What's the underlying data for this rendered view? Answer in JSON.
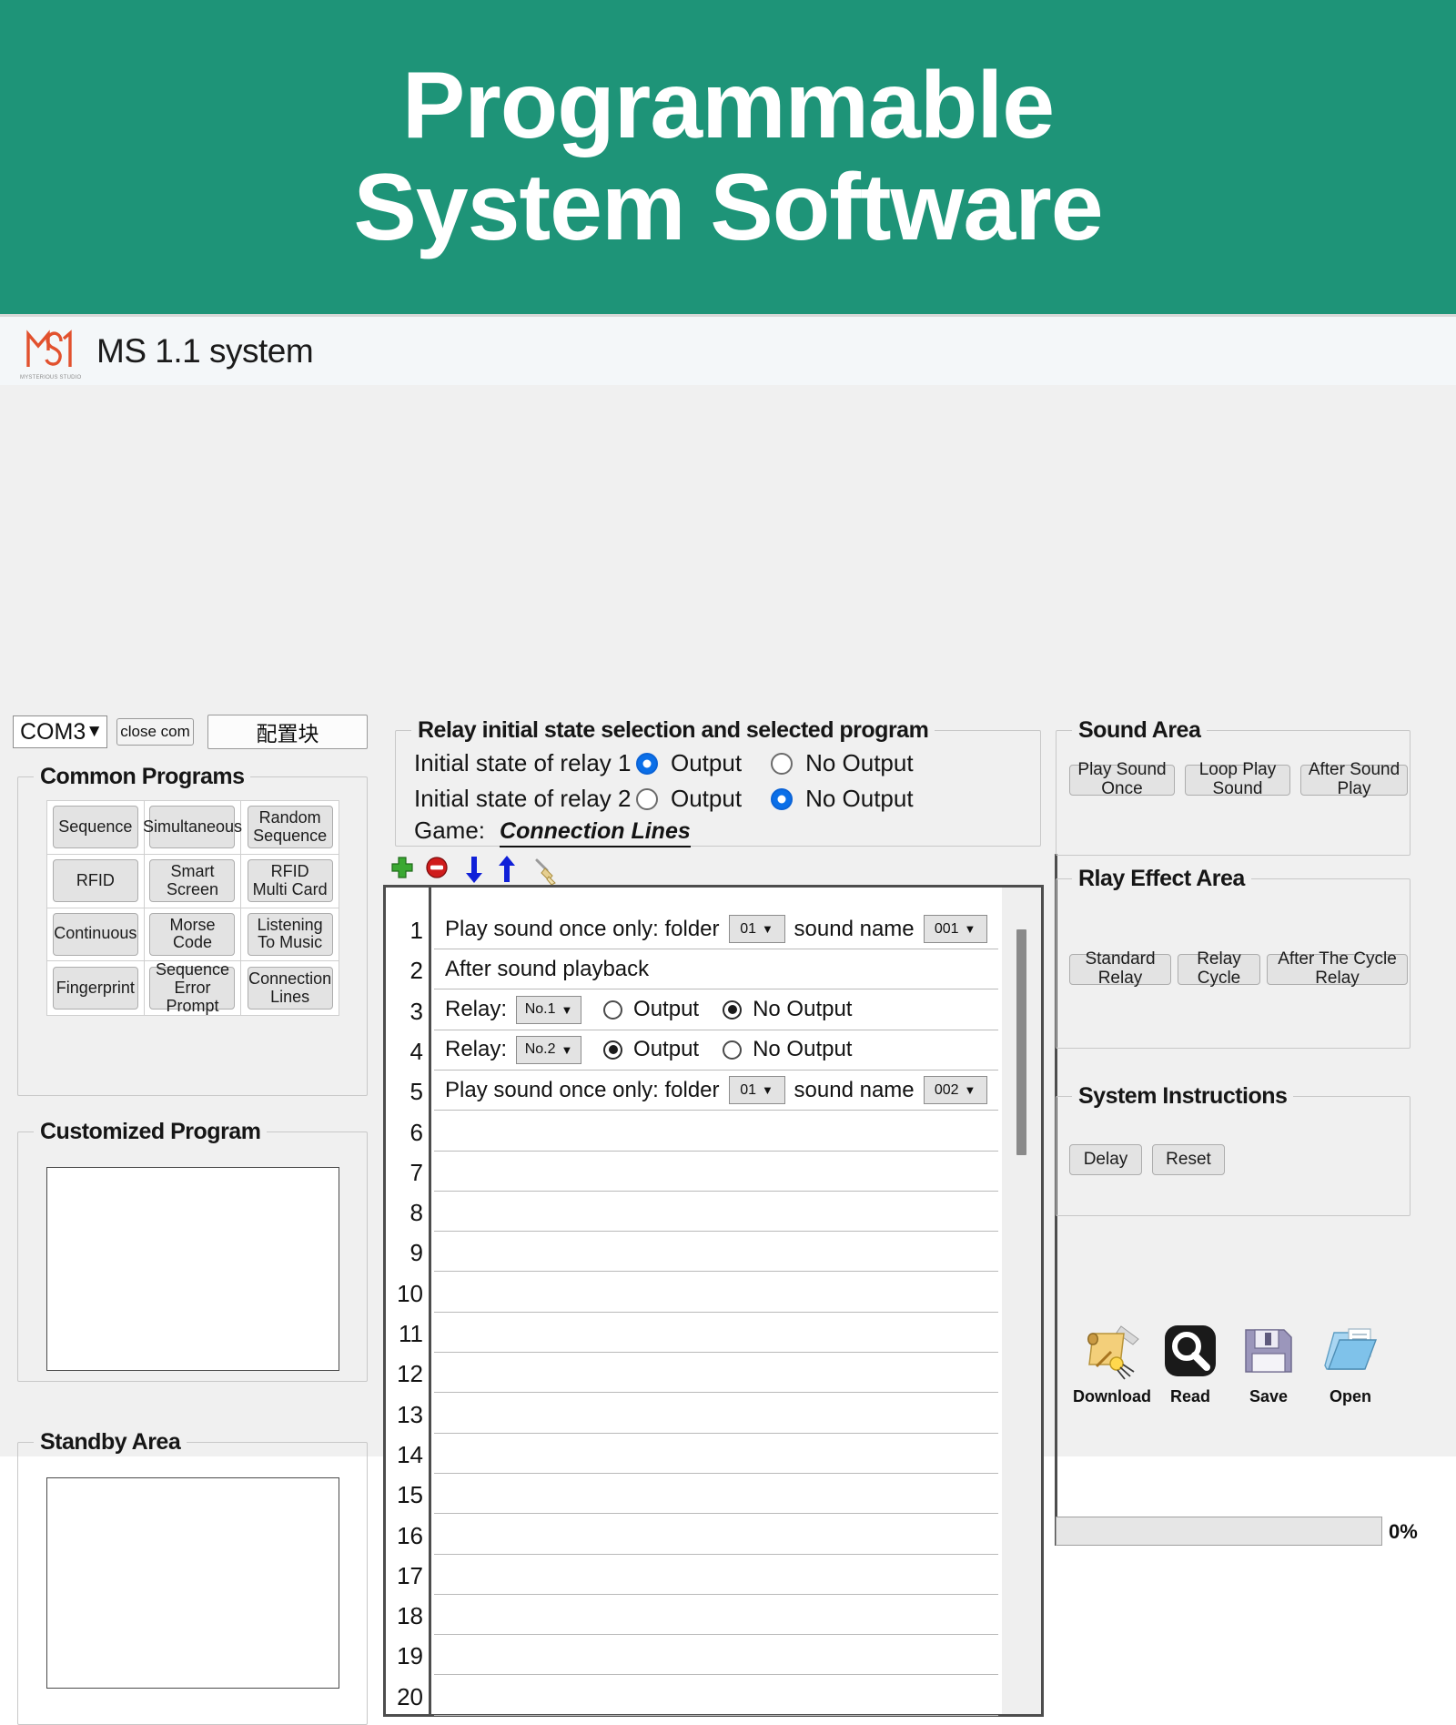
{
  "banner": {
    "line1": "Programmable",
    "line2": "System Software",
    "bg_color": "#1e9478"
  },
  "titlebar": {
    "app_title": "MS 1.1 system",
    "logo_caption": "MYSTERIOUS STUDIO"
  },
  "connection": {
    "port_value": "COM3",
    "caret": "▼",
    "close_com_label": "close com",
    "config_block_label": "配置块"
  },
  "common_programs": {
    "legend": "Common Programs",
    "buttons": [
      "Sequence",
      "Simultaneous",
      "Random\nSequence",
      "RFID",
      "Smart\nScreen",
      "RFID\nMulti Card",
      "Continuous",
      "Morse Code",
      "Listening\nTo Music",
      "Fingerprint",
      "Sequence\nError Prompt",
      "Connection\nLines"
    ]
  },
  "customized_program": {
    "legend": "Customized Program",
    "content": ""
  },
  "standby_area": {
    "legend": "Standby Area",
    "content": ""
  },
  "relay_panel": {
    "legend": "Relay initial state selection and selected program",
    "rows": [
      {
        "label": "Initial state of relay 1",
        "output_label": "Output",
        "no_output_label": "No Output",
        "selected": "output"
      },
      {
        "label": "Initial state of relay 2",
        "output_label": "Output",
        "no_output_label": "No Output",
        "selected": "no_output"
      }
    ],
    "game_label": "Game:",
    "game_value": "Connection Lines"
  },
  "toolbar": {
    "icons": [
      {
        "name": "add-icon",
        "title": "Add"
      },
      {
        "name": "delete-icon",
        "title": "Delete"
      },
      {
        "name": "move-down-icon",
        "title": "Move Down"
      },
      {
        "name": "move-up-icon",
        "title": "Move Up"
      },
      {
        "name": "clear-icon",
        "title": "Clear"
      }
    ]
  },
  "program_list": {
    "row_numbers": [
      "1",
      "2",
      "3",
      "4",
      "5",
      "6",
      "7",
      "8",
      "9",
      "10",
      "11",
      "12",
      "13",
      "14",
      "15",
      "16",
      "17",
      "18",
      "19",
      "20"
    ],
    "rows": [
      {
        "type": "sound",
        "text_before": "Play sound once only: folder",
        "folder_value": "01",
        "text_mid": "sound name",
        "sound_value": "001"
      },
      {
        "type": "text",
        "text": "After sound playback"
      },
      {
        "type": "relay",
        "label": "Relay:",
        "relay_value": "No.1",
        "output_label": "Output",
        "no_output_label": "No Output",
        "selected": "no_output"
      },
      {
        "type": "relay",
        "label": "Relay:",
        "relay_value": "No.2",
        "output_label": "Output",
        "no_output_label": "No Output",
        "selected": "output"
      },
      {
        "type": "sound",
        "text_before": "Play sound once only: folder",
        "folder_value": "01",
        "text_mid": "sound name",
        "sound_value": "002"
      }
    ],
    "caret": "▼"
  },
  "sound_area": {
    "legend": "Sound Area",
    "buttons": [
      "Play Sound Once",
      "Loop Play Sound",
      "After Sound Play"
    ]
  },
  "relay_effect_area": {
    "legend": "Rlay Effect Area",
    "buttons": [
      "Standard Relay",
      "Relay Cycle",
      "After The Cycle Relay"
    ]
  },
  "system_instructions": {
    "legend": "System Instructions",
    "buttons": [
      "Delay",
      "Reset"
    ]
  },
  "file_actions": [
    {
      "label": "Download",
      "icon": "scroll-quill-icon"
    },
    {
      "label": "Read",
      "icon": "magnifier-icon"
    },
    {
      "label": "Save",
      "icon": "floppy-disk-icon"
    },
    {
      "label": "Open",
      "icon": "open-folder-icon"
    }
  ],
  "progress": {
    "percent_label": "0%",
    "value": 0
  }
}
